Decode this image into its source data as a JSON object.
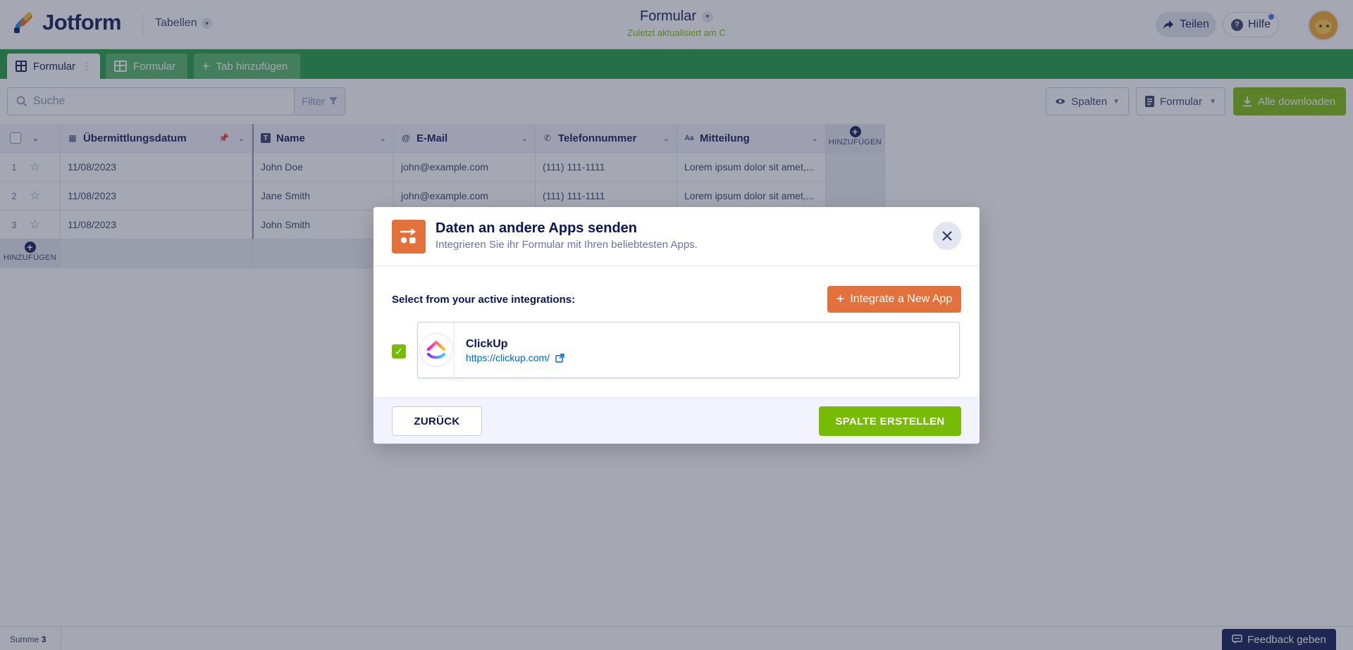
{
  "app": {
    "logo_text": "Jotform",
    "tables_menu": "Tabellen",
    "form_title": "Formular",
    "last_updated": "Zuletzt aktualisiert am C",
    "share_label": "Teilen",
    "help_label": "Hilfe"
  },
  "tabs": [
    {
      "label": "Formular",
      "active": true
    },
    {
      "label": "Formular",
      "active": false
    },
    {
      "label": "Tab hinzufügen",
      "active": false
    }
  ],
  "toolbar": {
    "search_placeholder": "Suche",
    "filter_label": "Filter",
    "columns_label": "Spalten",
    "form_label": "Formular",
    "download_label": "Alle downloaden"
  },
  "table": {
    "columns": [
      {
        "label": "Übermittlungsdatum",
        "icon": "calendar-icon"
      },
      {
        "label": "Name",
        "icon": "text-icon"
      },
      {
        "label": "E-Mail",
        "icon": "at-icon"
      },
      {
        "label": "Telefonnummer",
        "icon": "phone-icon"
      },
      {
        "label": "Mitteilung",
        "icon": "aa-icon"
      }
    ],
    "add_column_label": "HINZUFÜGEN",
    "add_row_label": "HINZUFÜGEN",
    "rows": [
      {
        "num": "1",
        "date": "11/08/2023",
        "name": "John Doe",
        "email": "john@example.com",
        "phone": "(111) 111-1111",
        "message": "Lorem ipsum dolor sit amet,..."
      },
      {
        "num": "2",
        "date": "11/08/2023",
        "name": "Jane Smith",
        "email": "john@example.com",
        "phone": "(111) 111-1111",
        "message": "Lorem ipsum dolor sit amet,..."
      },
      {
        "num": "3",
        "date": "11/08/2023",
        "name": "John Smith",
        "email": "",
        "phone": "",
        "message": ""
      }
    ]
  },
  "footer": {
    "sum_label": "Summe",
    "sum_value": "3",
    "feedback_label": "Feedback geben"
  },
  "modal": {
    "title": "Daten an andere Apps senden",
    "subtitle": "Integrieren Sie ihr Formular mit Ihren beliebtesten Apps.",
    "active_label": "Select from your active integrations:",
    "integrate_label": "Integrate a New App",
    "integration": {
      "name": "ClickUp",
      "url": "https://clickup.com/",
      "checked": true
    },
    "back_label": "ZURÜCK",
    "create_label": "SPALTE ERSTELLEN"
  },
  "colors": {
    "brand_navy": "#0a1551",
    "tab_green": "#1a9b3c",
    "accent_green": "#78bb07",
    "accent_orange": "#e3713b",
    "link_blue": "#0066c3"
  }
}
